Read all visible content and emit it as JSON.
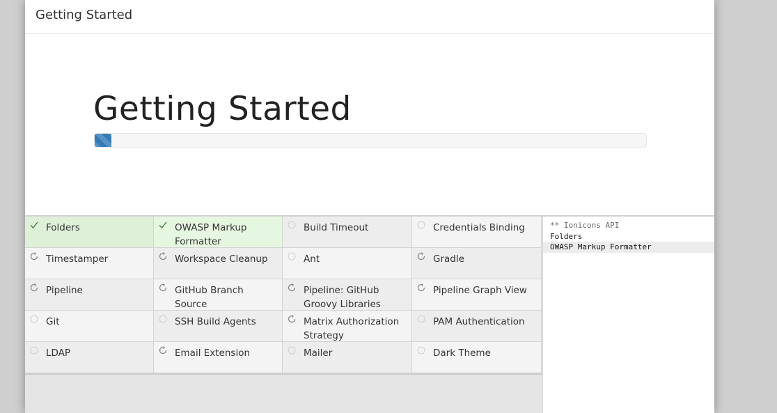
{
  "header": {
    "title": "Getting Started"
  },
  "hero": {
    "title": "Getting Started",
    "progress": 0.03
  },
  "colors": {
    "accent": "#337ab7",
    "success_bg": "#dff0d8",
    "check": "#3c763d"
  },
  "plugins": [
    {
      "name": "Folders",
      "status": "success",
      "icon": "check-icon"
    },
    {
      "name": "OWASP Markup Formatter",
      "status": "success",
      "icon": "check-icon"
    },
    {
      "name": "Build Timeout",
      "status": "pending",
      "icon": "circle-icon"
    },
    {
      "name": "Credentials Binding",
      "status": "pending",
      "icon": "circle-icon"
    },
    {
      "name": "Timestamper",
      "status": "installing",
      "icon": "refresh-icon"
    },
    {
      "name": "Workspace Cleanup",
      "status": "installing",
      "icon": "refresh-icon"
    },
    {
      "name": "Ant",
      "status": "pending",
      "icon": "circle-icon"
    },
    {
      "name": "Gradle",
      "status": "installing",
      "icon": "refresh-icon"
    },
    {
      "name": "Pipeline",
      "status": "installing",
      "icon": "refresh-icon"
    },
    {
      "name": "GitHub Branch Source",
      "status": "installing",
      "icon": "refresh-icon"
    },
    {
      "name": "Pipeline: GitHub Groovy Libraries",
      "status": "installing",
      "icon": "refresh-icon"
    },
    {
      "name": "Pipeline Graph View",
      "status": "installing",
      "icon": "refresh-icon"
    },
    {
      "name": "Git",
      "status": "pending",
      "icon": "circle-icon"
    },
    {
      "name": "SSH Build Agents",
      "status": "pending",
      "icon": "circle-icon"
    },
    {
      "name": "Matrix Authorization Strategy",
      "status": "installing",
      "icon": "refresh-icon"
    },
    {
      "name": "PAM Authentication",
      "status": "pending",
      "icon": "circle-icon"
    },
    {
      "name": "LDAP",
      "status": "pending",
      "icon": "circle-icon"
    },
    {
      "name": "Email Extension",
      "status": "installing",
      "icon": "refresh-icon"
    },
    {
      "name": "Mailer",
      "status": "pending",
      "icon": "circle-icon"
    },
    {
      "name": "Dark Theme",
      "status": "pending",
      "icon": "circle-icon"
    }
  ],
  "log": [
    "** Ionicons API",
    "Folders",
    "OWASP Markup Formatter"
  ]
}
